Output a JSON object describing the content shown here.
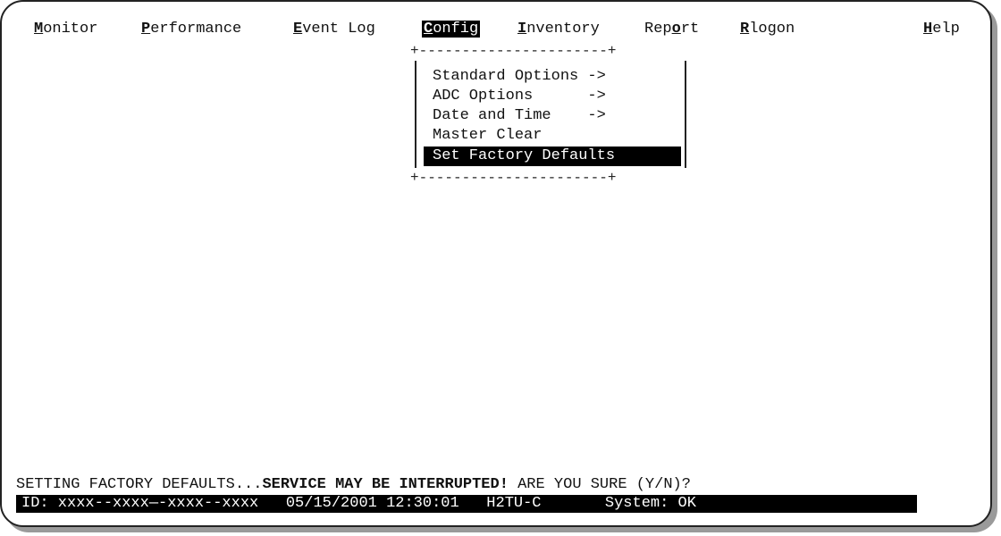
{
  "menubar": {
    "items": [
      {
        "accel": "M",
        "rest": "onitor"
      },
      {
        "accel": "P",
        "rest": "erformance"
      },
      {
        "accel": "E",
        "rest": "vent Log"
      },
      {
        "accel": "C",
        "rest": "onfig"
      },
      {
        "accel": "I",
        "rest": "nventory"
      },
      {
        "pre": "Rep",
        "accel": "o",
        "rest": "rt"
      },
      {
        "accel": "R",
        "rest": "logon"
      },
      {
        "accel": "H",
        "rest": "elp"
      }
    ]
  },
  "dropdown": {
    "top_border": "+----------------------+",
    "bottom_border": "+----------------------+",
    "items": [
      "Standard Options ->",
      "ADC Options      ->",
      "Date and Time    ->",
      "Master Clear",
      "Set Factory Defaults"
    ]
  },
  "prompt": {
    "part1": "SETTING FACTORY DEFAULTS...",
    "part2": "SERVICE MAY BE INTERRUPTED!",
    "part3": " ARE YOU SURE (Y/N)?"
  },
  "status": {
    "text": "ID: xxxx--xxxx—-xxxx--xxxx   05/15/2001 12:30:01   H2TU-C       System: OK"
  }
}
